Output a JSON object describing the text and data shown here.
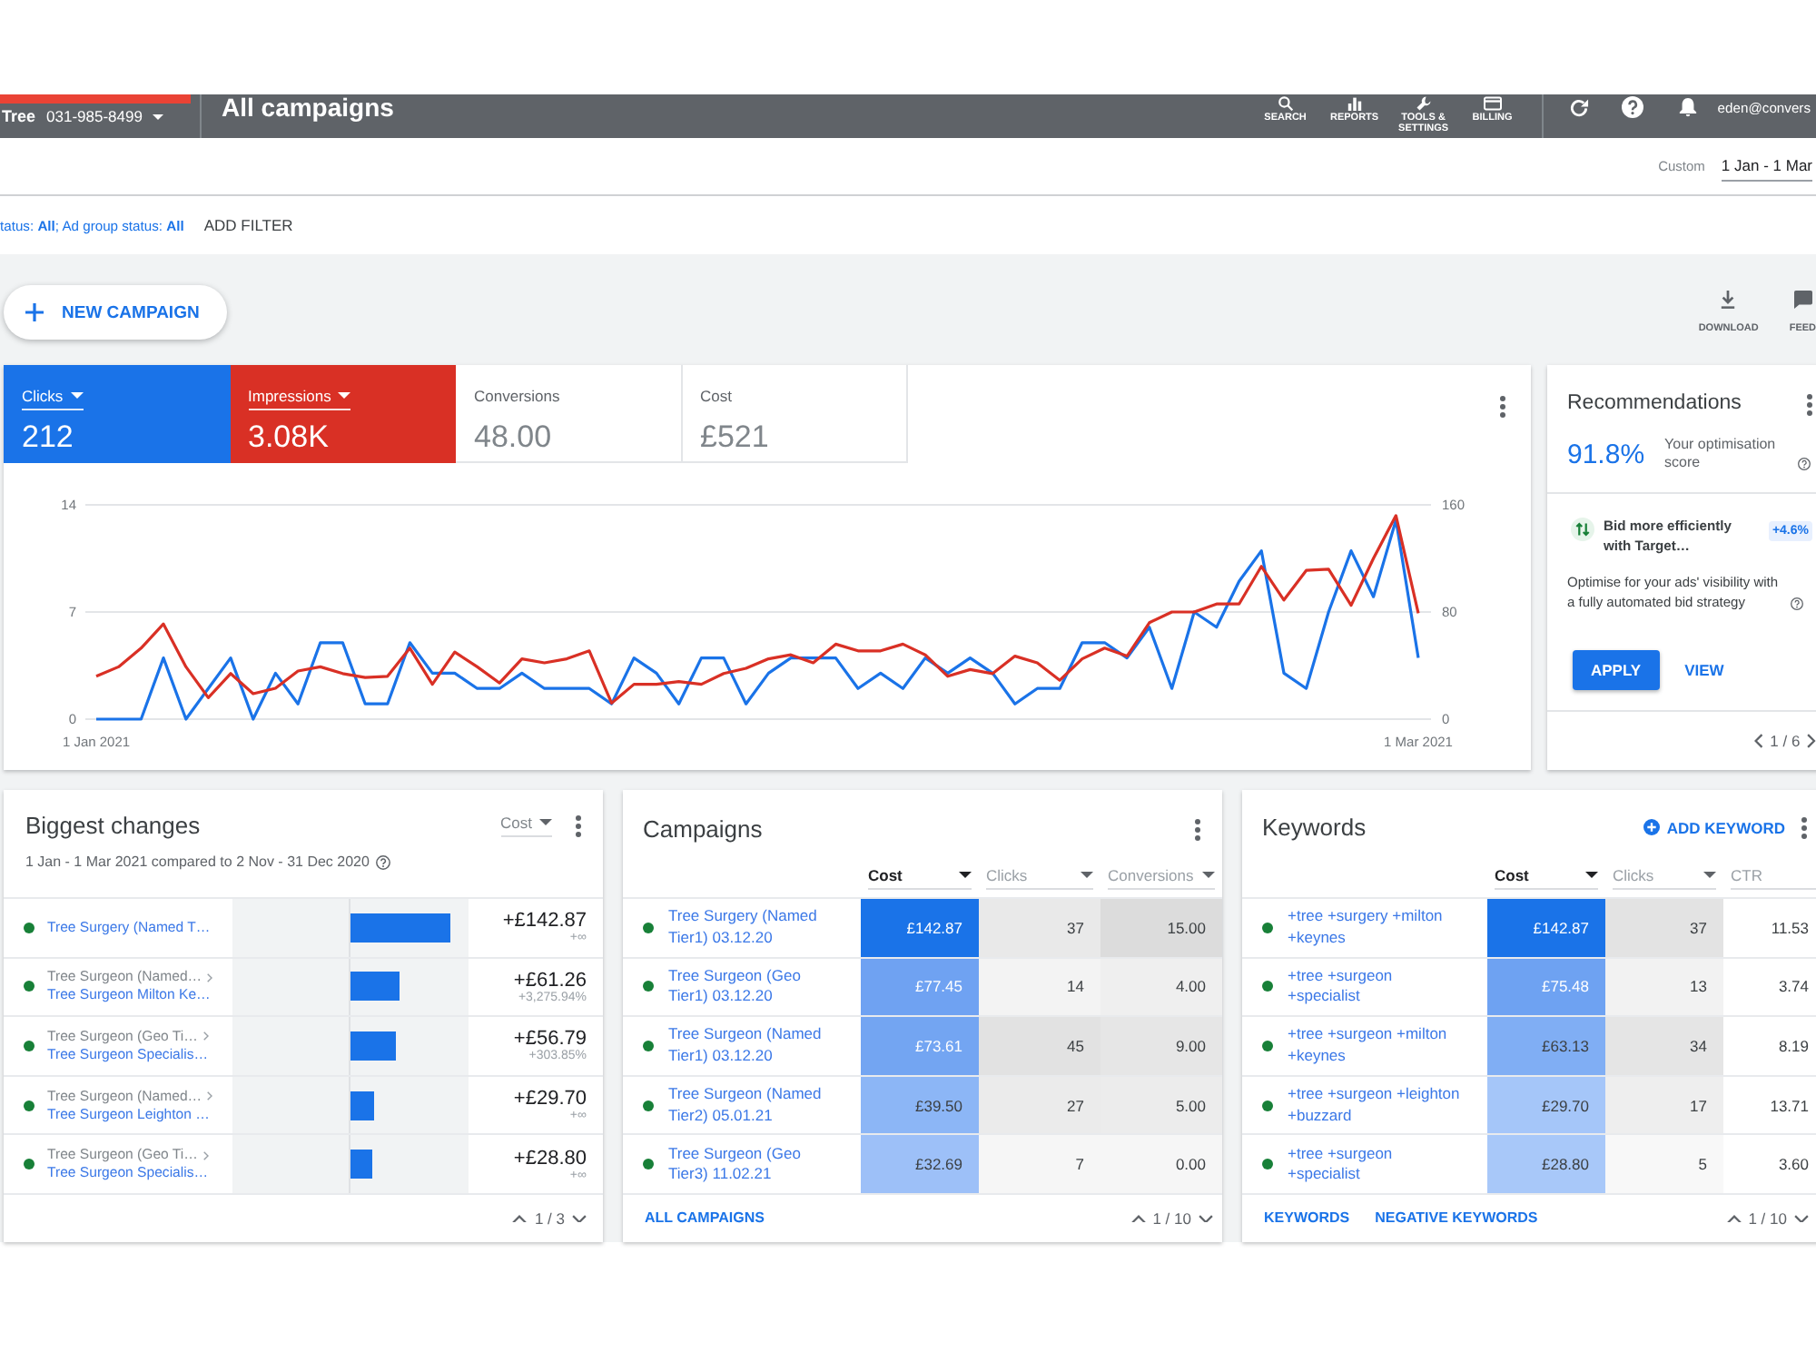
{
  "top_bar": {
    "account_name": "Tree",
    "account_id": "031-985-8499",
    "page_title": "All campaigns",
    "tools": [
      {
        "kind": "search",
        "label": "SEARCH"
      },
      {
        "kind": "reports",
        "label": "REPORTS"
      },
      {
        "kind": "tools",
        "label": "TOOLS & SETTINGS"
      },
      {
        "kind": "billing",
        "label": "BILLING"
      }
    ],
    "user_email": "eden@convers"
  },
  "date_range": {
    "label": "Custom",
    "value": "1 Jan - 1 Mar"
  },
  "filter_bar": {
    "summary": "tatus: **All**; Ad group status: **All**",
    "add_filter": "ADD FILTER"
  },
  "new_campaign_button": "NEW CAMPAIGN",
  "page_actions": [
    {
      "kind": "download",
      "label": "DOWNLOAD"
    },
    {
      "kind": "feedback",
      "label": "FEED"
    }
  ],
  "overview": {
    "metrics": [
      {
        "label": "Clicks",
        "value": "212",
        "selected": true,
        "color": "#1a73e8"
      },
      {
        "label": "Impressions",
        "value": "3.08K",
        "selected": true,
        "color": "#d93025"
      },
      {
        "label": "Conversions",
        "value": "48.00",
        "selected": false
      },
      {
        "label": "Cost",
        "value": "£521",
        "selected": false
      }
    ],
    "chart_data": {
      "type": "line",
      "categories": [
        "1 Jan 2021",
        null,
        null,
        null,
        null,
        null,
        null,
        null,
        null,
        null,
        null,
        null,
        null,
        null,
        null,
        null,
        null,
        null,
        null,
        null,
        null,
        null,
        null,
        null,
        null,
        null,
        null,
        null,
        null,
        null,
        null,
        null,
        null,
        null,
        null,
        null,
        null,
        null,
        null,
        null,
        null,
        null,
        null,
        null,
        null,
        null,
        null,
        null,
        null,
        null,
        null,
        null,
        null,
        null,
        null,
        null,
        null,
        null,
        null,
        "1 Mar 2021"
      ],
      "ylim": [
        0,
        14
      ],
      "yticks": [
        0,
        7,
        14
      ],
      "y2lim": [
        0,
        160
      ],
      "y2ticks": [
        0,
        80,
        160
      ],
      "series": [
        {
          "color": "#1a73e8",
          "values": [
            0,
            0,
            0,
            4,
            0,
            2,
            4,
            0,
            3,
            1,
            5,
            5,
            1,
            1,
            5,
            3,
            3,
            2,
            2,
            3,
            2,
            2,
            2,
            1,
            4,
            3,
            1,
            4,
            4,
            1,
            3,
            4,
            4,
            4,
            2,
            3,
            2,
            4,
            3,
            4,
            3,
            1,
            2,
            2,
            5,
            5,
            4,
            6,
            2,
            7,
            6,
            9,
            11,
            3,
            2,
            7,
            11,
            8,
            13,
            4
          ]
        },
        {
          "color": "#d93025",
          "axis": "y2",
          "values": [
            32,
            39,
            53,
            71,
            39,
            16,
            34,
            19,
            23,
            36,
            39,
            34,
            31,
            32,
            53,
            26,
            50,
            39,
            27,
            45,
            42,
            45,
            51,
            12,
            26,
            26,
            28,
            26,
            34,
            38,
            45,
            48,
            42,
            56,
            51,
            51,
            56,
            48,
            32,
            37,
            34,
            47,
            42,
            29,
            45,
            53,
            47,
            72,
            80,
            80,
            86,
            86,
            114,
            89,
            111,
            112,
            85,
            120,
            152,
            79
          ]
        }
      ]
    }
  },
  "recommendations": {
    "title": "Recommendations",
    "score": "91.8%",
    "score_label": "Your optimisation score",
    "item": {
      "title": "Bid more efficiently with Target…",
      "uplift": "+4.6%",
      "description": "Optimise for your ads' visibility with a fully automated bid strategy"
    },
    "actions": [
      {
        "kind": "primary",
        "label": "APPLY"
      },
      {
        "kind": "text",
        "label": "VIEW"
      }
    ],
    "pager": "1 / 6"
  },
  "biggest_changes": {
    "title": "Biggest changes",
    "subtitle": "1 Jan - 1 Mar 2021 compared to 2 Nov - 31 Dec 2020",
    "metric": "Cost",
    "rows": [
      {
        "campaign": "Tree Surgery (Named T…",
        "level": 0.84,
        "change": "+£142.87",
        "percent": "+∞"
      },
      {
        "campaign": "Tree Surgeon (Named…",
        "ad_group": "Tree Surgeon Milton Ke…",
        "level": 0.42,
        "change": "+£61.26",
        "percent": "+3,275.94%"
      },
      {
        "campaign": "Tree Surgeon (Geo Ti…",
        "ad_group": "Tree Surgeon Specialis…",
        "level": 0.39,
        "change": "+£56.79",
        "percent": "+303.85%"
      },
      {
        "campaign": "Tree Surgeon (Named…",
        "ad_group": "Tree Surgeon Leighton …",
        "level": 0.2,
        "change": "+£29.70",
        "percent": "+∞"
      },
      {
        "campaign": "Tree Surgeon (Geo Ti…",
        "ad_group": "Tree Surgeon Specialis…",
        "level": 0.19,
        "change": "+£28.80",
        "percent": "+∞"
      }
    ],
    "pager": "1 / 3"
  },
  "campaigns": {
    "title": "Campaigns",
    "columns": [
      {
        "label": "Cost",
        "selected": true,
        "caret": true
      },
      {
        "label": "Clicks",
        "selected": false,
        "caret": true
      },
      {
        "label": "Conversions",
        "selected": false,
        "caret": true
      }
    ],
    "rows": [
      {
        "name": "Tree Surgery (Named Tier1) 03.12.20",
        "cells": [
          {
            "text": "£142.87",
            "color": "#1a73e8"
          },
          {
            "text": "37",
            "color": "#e9e9e9"
          },
          {
            "text": "15.00",
            "color": "#dcdcdc"
          }
        ]
      },
      {
        "name": "Tree Surgeon (Geo Tier1) 03.12.20",
        "cells": [
          {
            "text": "£77.45",
            "color": "#6fa2f2"
          },
          {
            "text": "14",
            "color": "#f3f3f3"
          },
          {
            "text": "4.00",
            "color": "#efefef"
          }
        ]
      },
      {
        "name": "Tree Surgeon (Named Tier1) 03.12.20",
        "cells": [
          {
            "text": "£73.61",
            "color": "#73a5f2"
          },
          {
            "text": "45",
            "color": "#e2e2e2"
          },
          {
            "text": "9.00",
            "color": "#e6e6e6"
          }
        ]
      },
      {
        "name": "Tree Surgeon (Named Tier2) 05.01.21",
        "cells": [
          {
            "text": "£39.50",
            "color": "#8cb6f6"
          },
          {
            "text": "27",
            "color": "#ebebeb"
          },
          {
            "text": "5.00",
            "color": "#ececec"
          }
        ]
      },
      {
        "name": "Tree Surgeon (Geo Tier3) 11.02.21",
        "cells": [
          {
            "text": "£32.69",
            "color": "#9dc0f8"
          },
          {
            "text": "7",
            "color": "#f6f6f6"
          },
          {
            "text": "0.00",
            "color": "#f6f6f6"
          }
        ]
      }
    ],
    "footer_link": "ALL CAMPAIGNS",
    "pager": "1 / 10"
  },
  "keywords": {
    "title": "Keywords",
    "add_label": "ADD KEYWORD",
    "columns": [
      {
        "label": "Cost",
        "selected": true,
        "caret": true
      },
      {
        "label": "Clicks",
        "selected": false,
        "caret": true
      },
      {
        "label": "CTR",
        "selected": false,
        "caret": false
      }
    ],
    "rows": [
      {
        "keyword": "+tree +surgery +milton +keynes",
        "cells": [
          {
            "text": "£142.87",
            "color": "#1a73e8"
          },
          {
            "text": "37",
            "color": "#e3e3e3"
          },
          {
            "text": "11.53"
          }
        ]
      },
      {
        "keyword": "+tree +surgeon +specialist",
        "cells": [
          {
            "text": "£75.48",
            "color": "#6ea2f2"
          },
          {
            "text": "13",
            "color": "#f2f2f2"
          },
          {
            "text": "3.74"
          }
        ]
      },
      {
        "keyword": "+tree +surgeon +milton +keynes",
        "cells": [
          {
            "text": "£63.13",
            "color": "#80aef4"
          },
          {
            "text": "34",
            "color": "#e5e5e5"
          },
          {
            "text": "8.19"
          }
        ]
      },
      {
        "keyword": "+tree +surgeon +leighton +buzzard",
        "cells": [
          {
            "text": "£29.70",
            "color": "#a5c6f9"
          },
          {
            "text": "17",
            "color": "#eeeeee"
          },
          {
            "text": "13.71"
          }
        ]
      },
      {
        "keyword": "+tree +surgeon +specialist",
        "cells": [
          {
            "text": "£28.80",
            "color": "#a8c8f9"
          },
          {
            "text": "5",
            "color": "#f8f8f8"
          },
          {
            "text": "3.60"
          }
        ]
      }
    ],
    "footer_links": [
      "KEYWORDS",
      "NEGATIVE KEYWORDS"
    ],
    "pager": "1 / 10"
  }
}
